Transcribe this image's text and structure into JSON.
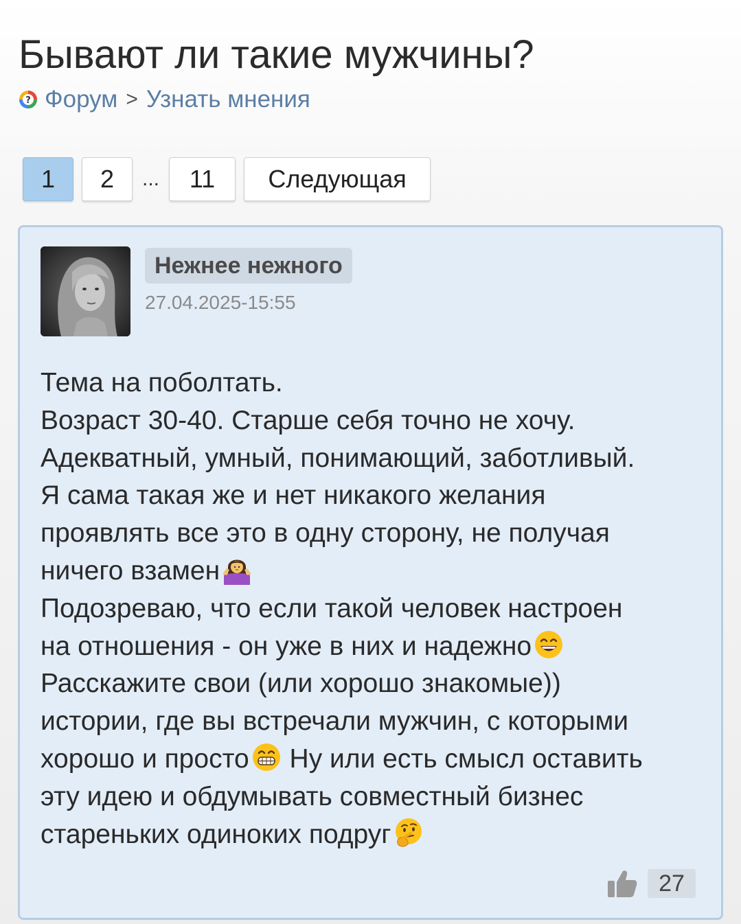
{
  "page": {
    "title": "Бывают ли такие мужчины?"
  },
  "breadcrumb": {
    "forum_label": "Форум",
    "separator": ">",
    "section_label": "Узнать мнения"
  },
  "pagination": {
    "pages": [
      "1",
      "2",
      "11"
    ],
    "ellipsis": "...",
    "next_label": "Следующая",
    "current_page": "1"
  },
  "post": {
    "author": "Нежнее нежного",
    "date": "27.04.2025-15:55",
    "lines": [
      "Тема на поболтать.",
      "Возраст 30-40. Старше себя точно не хочу.",
      "Адекватный, умный, понимающий, заботливый.",
      "Я сама такая же и нет никакого желания",
      "проявлять все это в одну сторону, не получая",
      "ничего взамен",
      "Подозреваю, что если такой человек настроен",
      "на отношения - он уже в них и надежно",
      "Расскажите свои (или хорошо знакомые))",
      "истории, где вы встречали мужчин, с которыми",
      "хорошо и просто",
      " Ну или есть смысл оставить",
      "эту идею и обдумывать совместный бизнес",
      "стареньких одиноких подруг"
    ],
    "like_count": "27"
  },
  "icons": {
    "forum": "forum-question-icon",
    "like": "thumbs-up-icon",
    "shrug": "woman-shrugging-emoji",
    "laugh": "grinning-smiling-eyes-emoji",
    "grin": "beaming-grin-emoji",
    "thinking": "thinking-face-emoji"
  },
  "colors": {
    "link": "#5b7fa5",
    "active_page": "#a9cdec",
    "post_bg": "#e3edf8",
    "post_border": "#b5cde3"
  }
}
